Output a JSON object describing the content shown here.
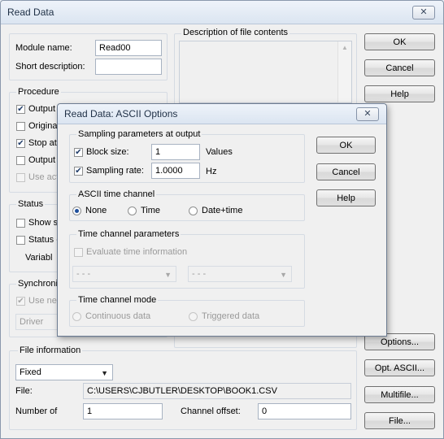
{
  "main": {
    "title": "Read Data",
    "close_glyph": "✕",
    "module_name_label": "Module name:",
    "module_name_value": "Read00",
    "short_desc_label": "Short description:",
    "short_desc_value": "",
    "description_label": "Description of file contents",
    "procedure": {
      "legend": "Procedure",
      "items": [
        {
          "label": "Output",
          "checked": true,
          "disabled": false
        },
        {
          "label": "Original",
          "checked": false,
          "disabled": false
        },
        {
          "label": "Stop at",
          "checked": true,
          "disabled": false
        },
        {
          "label": "Output",
          "checked": false,
          "disabled": false
        },
        {
          "label": "Use act",
          "checked": false,
          "disabled": true
        }
      ]
    },
    "status": {
      "legend": "Status",
      "items": [
        {
          "label": "Show s"
        },
        {
          "label": "Status -"
        }
      ],
      "variable_label": "Variabl"
    },
    "sync": {
      "legend": "Synchroni",
      "use_label": "Use ne",
      "driver_value": "Driver"
    },
    "buttons": {
      "ok": "OK",
      "cancel": "Cancel",
      "help": "Help",
      "options": "Options...",
      "opt_ascii": "Opt. ASCII...",
      "multifile": "Multifile...",
      "file": "File..."
    },
    "file_info": {
      "legend": "File information",
      "type_value": "Fixed",
      "file_label": "File:",
      "file_path": "C:\\USERS\\CJBUTLER\\DESKTOP\\BOOK1.CSV",
      "number_label": "Number of",
      "number_value": "1",
      "channel_offset_label": "Channel offset:",
      "channel_offset_value": "0"
    }
  },
  "dialog": {
    "title": "Read Data: ASCII Options",
    "close_glyph": "✕",
    "sampling": {
      "legend": "Sampling parameters at output",
      "block_size_label": "Block size:",
      "block_size_value": "1",
      "block_size_unit": "Values",
      "sampling_rate_label": "Sampling rate:",
      "sampling_rate_value": "1.0000",
      "sampling_rate_unit": "Hz"
    },
    "time_channel": {
      "legend": "ASCII time channel",
      "options": [
        "None",
        "Time",
        "Date+time"
      ],
      "selected": "None"
    },
    "time_params": {
      "legend": "Time channel parameters",
      "evaluate_label": "Evaluate time information",
      "select1_value": "- - -",
      "select2_value": "- - -"
    },
    "time_mode": {
      "legend": "Time channel mode",
      "options": [
        "Continuous data",
        "Triggered data"
      ]
    },
    "buttons": {
      "ok": "OK",
      "cancel": "Cancel",
      "help": "Help"
    }
  }
}
